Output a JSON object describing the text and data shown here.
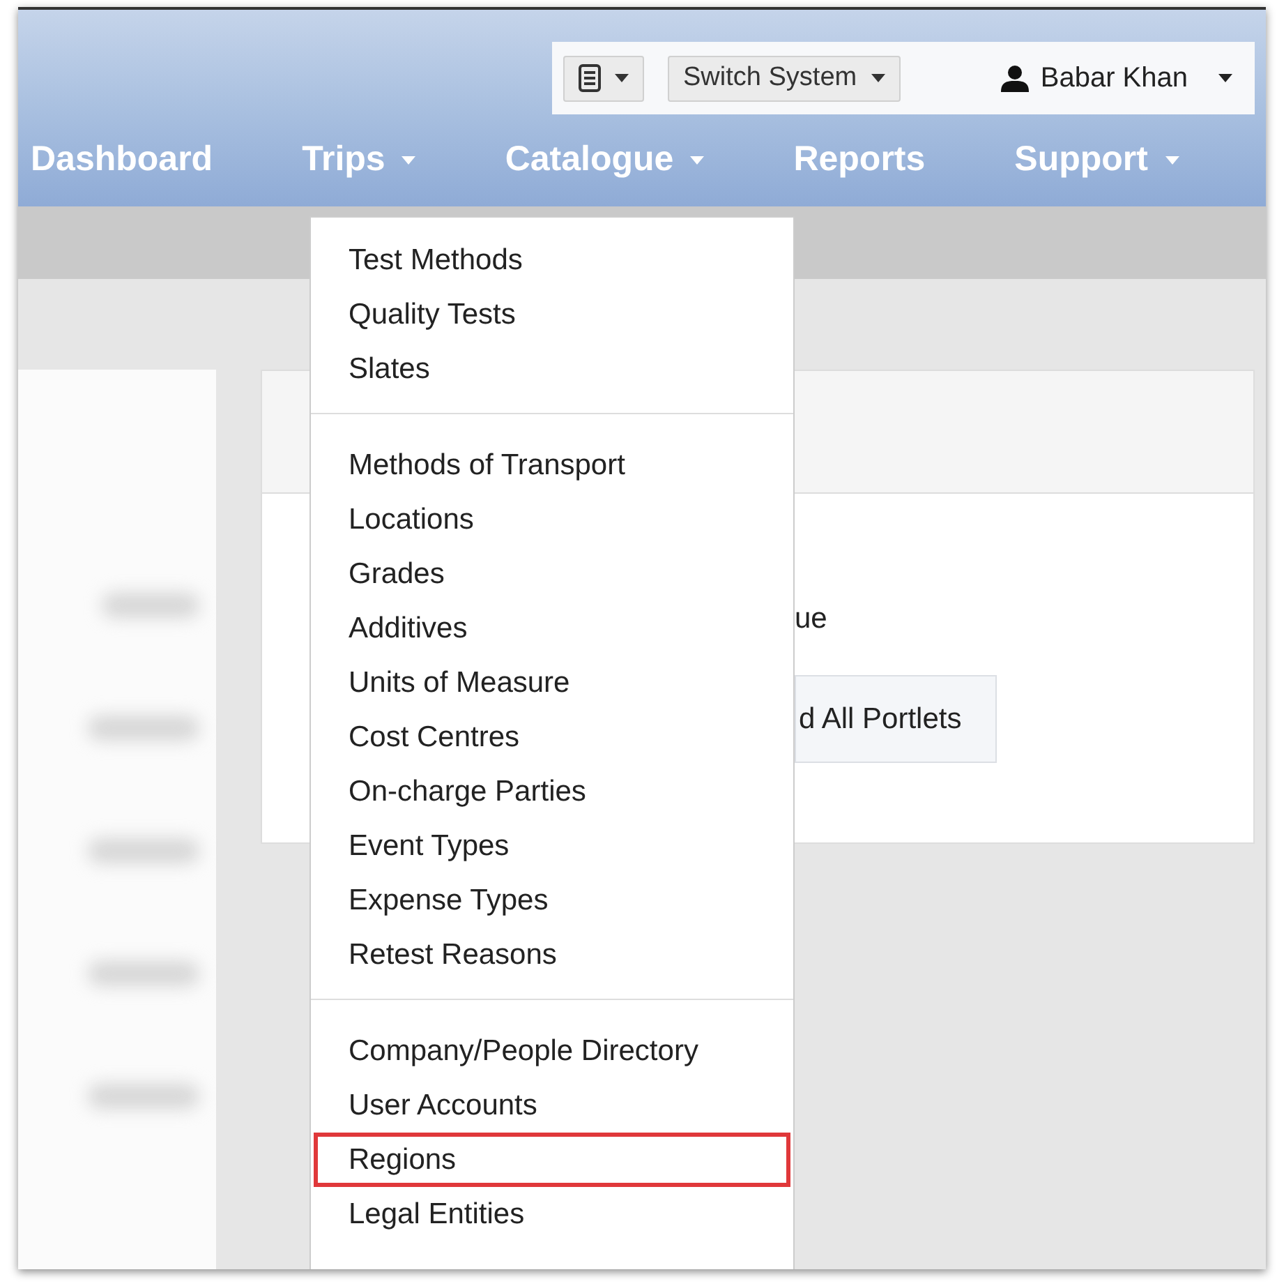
{
  "toolbar": {
    "book_button": {
      "kind": "dropdown"
    },
    "system_button": {
      "label": "Switch System"
    },
    "user_menu": {
      "label": "Babar Khan"
    }
  },
  "nav": [
    {
      "label": "Dashboard",
      "caret": false
    },
    {
      "label": "Trips",
      "caret": true
    },
    {
      "label": "Catalogue",
      "caret": true
    },
    {
      "label": "Reports",
      "caret": false
    },
    {
      "label": "Support",
      "caret": true
    }
  ],
  "card": {
    "text": "ue",
    "button": "d All Portlets"
  },
  "menu": {
    "sections": [
      {
        "items": [
          {
            "label": "Test Methods",
            "highlighted": false
          },
          {
            "label": "Quality Tests",
            "highlighted": false
          },
          {
            "label": "Slates",
            "highlighted": false
          }
        ]
      },
      {
        "items": [
          {
            "label": "Methods of Transport",
            "highlighted": false
          },
          {
            "label": "Locations",
            "highlighted": false
          },
          {
            "label": "Grades",
            "highlighted": false
          },
          {
            "label": "Additives",
            "highlighted": false
          },
          {
            "label": "Units of Measure",
            "highlighted": false
          },
          {
            "label": "Cost Centres",
            "highlighted": false
          },
          {
            "label": "On-charge Parties",
            "highlighted": false
          },
          {
            "label": "Event Types",
            "highlighted": false
          },
          {
            "label": "Expense Types",
            "highlighted": false
          },
          {
            "label": "Retest Reasons",
            "highlighted": false
          }
        ]
      },
      {
        "items": [
          {
            "label": "Company/People Directory",
            "highlighted": false
          },
          {
            "label": "User Accounts",
            "highlighted": false
          },
          {
            "label": "Regions",
            "highlighted": true
          },
          {
            "label": "Legal Entities",
            "highlighted": false
          }
        ]
      }
    ]
  }
}
